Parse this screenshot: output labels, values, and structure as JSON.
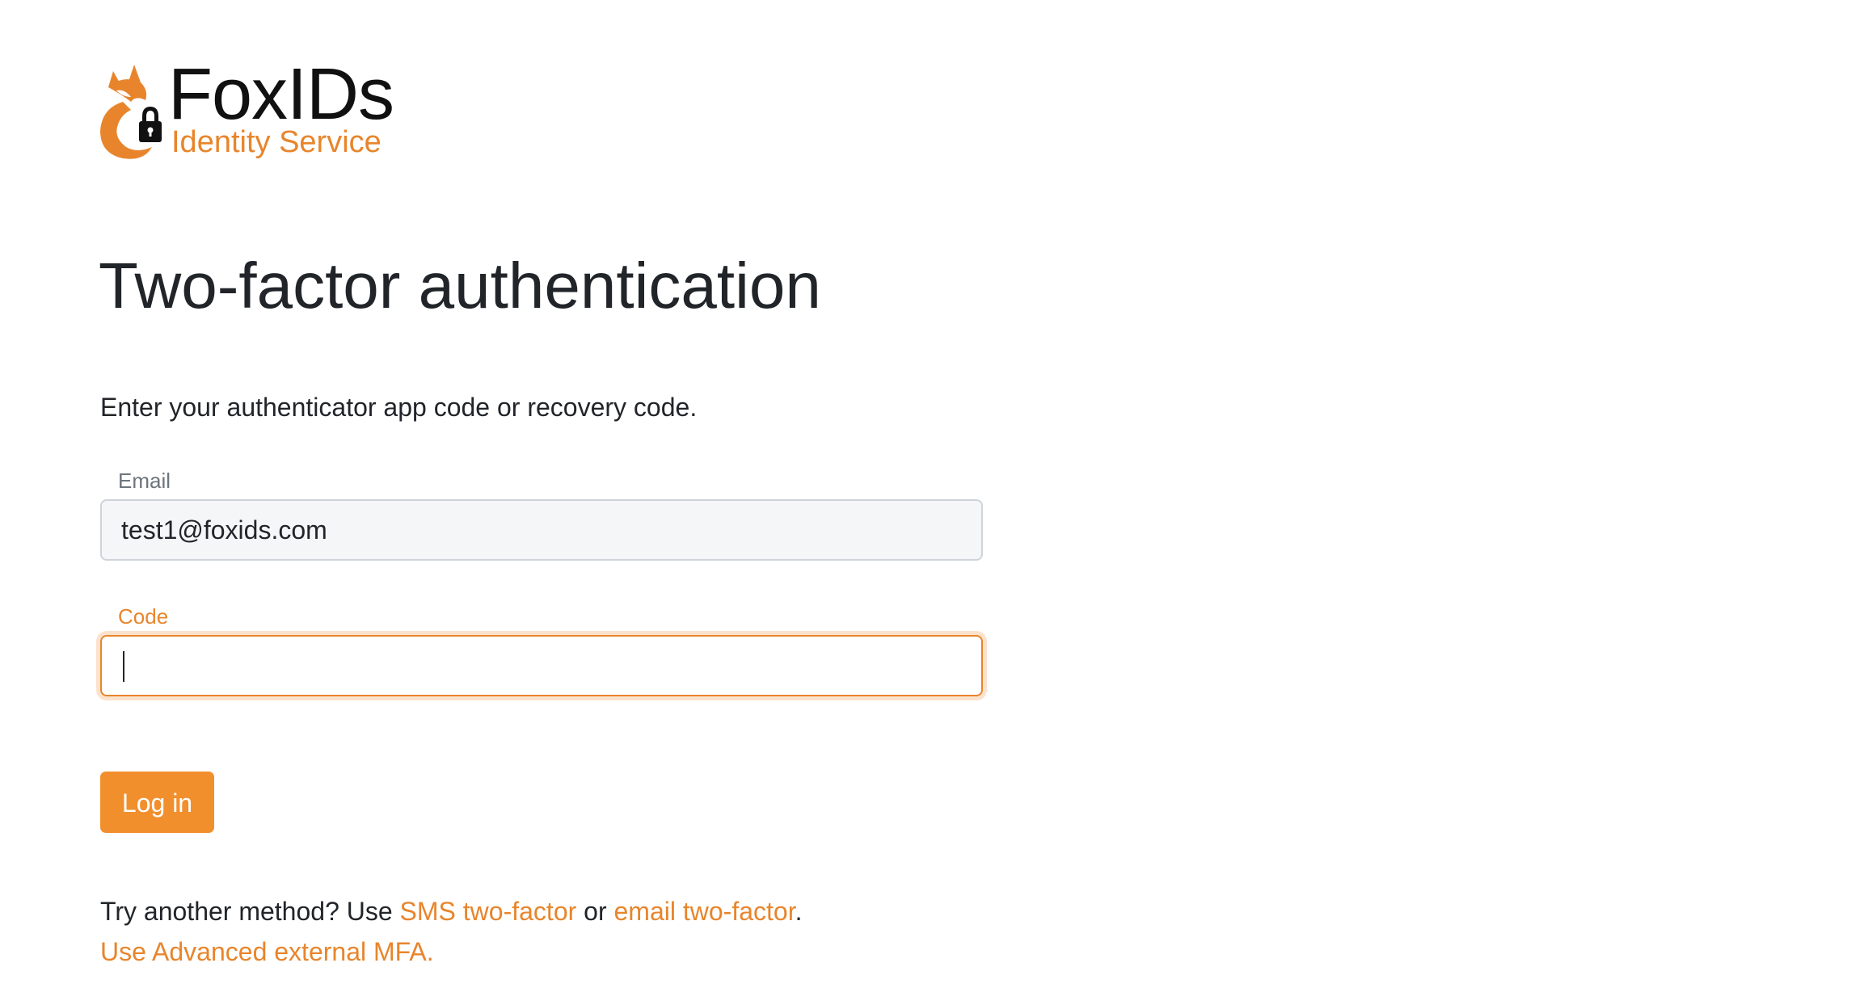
{
  "brand": {
    "title": "FoxIDs",
    "subtitle": "Identity Service",
    "accent_color": "#e8852c",
    "button_color": "#f28f2d"
  },
  "page": {
    "heading": "Two-factor authentication",
    "instruction": "Enter your authenticator app code or recovery code."
  },
  "form": {
    "email": {
      "label": "Email",
      "value": "test1@foxids.com"
    },
    "code": {
      "label": "Code",
      "value": "",
      "placeholder": ""
    },
    "submit_label": "Log in"
  },
  "alternatives": {
    "prefix": "Try another method? Use ",
    "sms_link": "SMS two-factor",
    "joiner": " or ",
    "email_link": "email two-factor",
    "suffix": ".",
    "external_mfa_link": "Use Advanced external MFA."
  },
  "icons": {
    "logo": "fox-lock-icon"
  }
}
